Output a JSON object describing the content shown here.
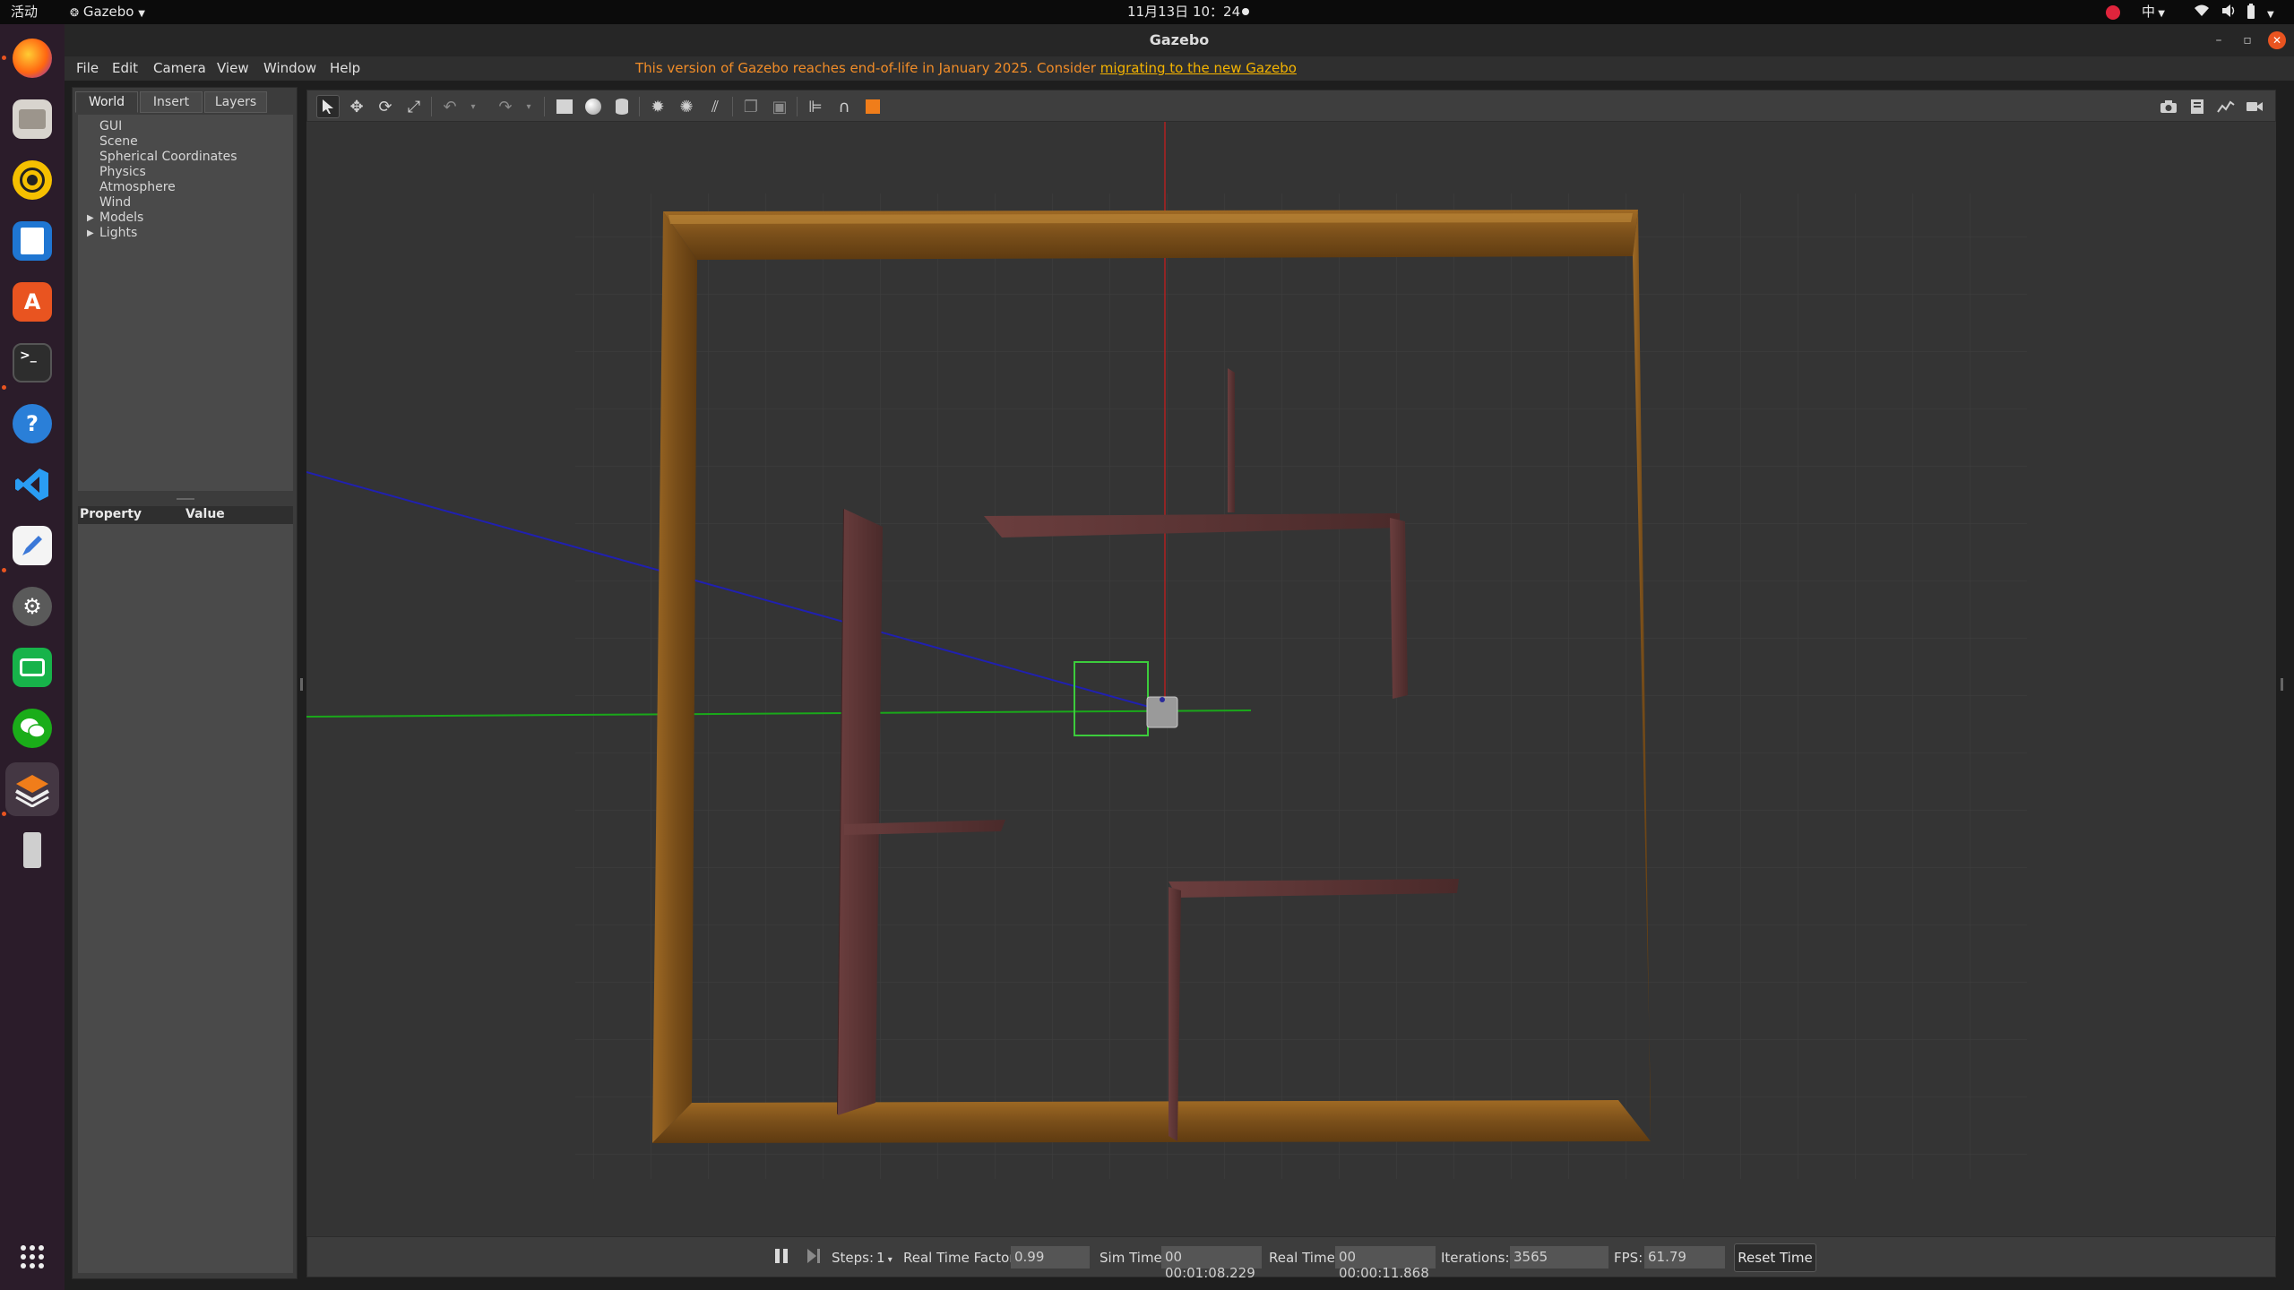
{
  "topbar": {
    "activities": "活动",
    "app_menu": "Gazebo",
    "clock": "11月13日 10：24",
    "input_method": "中"
  },
  "window": {
    "title": "Gazebo"
  },
  "menubar": {
    "items": [
      "File",
      "Edit",
      "Camera",
      "View",
      "Window",
      "Help"
    ],
    "notice_text": "This version of Gazebo reaches end-of-life in January 2025. Consider ",
    "notice_link": "migrating to the new Gazebo"
  },
  "left_panel": {
    "tabs": [
      "World",
      "Insert",
      "Layers"
    ],
    "tree_items": [
      "GUI",
      "Scene",
      "Spherical Coordinates",
      "Physics",
      "Atmosphere",
      "Wind",
      "Models",
      "Lights"
    ],
    "property_header": "Property",
    "value_header": "Value"
  },
  "toolbar": {
    "tools": [
      "select-icon",
      "translate-icon",
      "rotate-icon",
      "scale-icon",
      "undo-icon",
      "redo-icon",
      "box-icon",
      "sphere-icon",
      "cylinder-icon",
      "point-light-icon",
      "spot-light-icon",
      "directional-light-icon",
      "copy-icon",
      "paste-icon",
      "align-icon",
      "snap-icon",
      "view-angle-icon",
      "screenshot-icon",
      "log-icon",
      "plot-icon",
      "record-icon"
    ]
  },
  "bottom_bar": {
    "steps_label": "Steps:",
    "steps_value": "1",
    "rtf_label": "Real Time Factor:",
    "rtf_value": "0.99",
    "sim_time_label": "Sim Time:",
    "sim_time_value": "00 00:01:08.229",
    "real_time_label": "Real Time:",
    "real_time_value": "00 00:00:11.868",
    "iterations_label": "Iterations:",
    "iterations_value": "3565",
    "fps_label": "FPS:",
    "fps_value": "61.79",
    "reset_label": "Reset Time"
  },
  "colors": {
    "notice": "#f08c28",
    "notice_link": "#f5b400",
    "wall_frame": "#8a5a1c",
    "inner_wall": "#5a3535",
    "selection_box": "#3ccc3c"
  }
}
